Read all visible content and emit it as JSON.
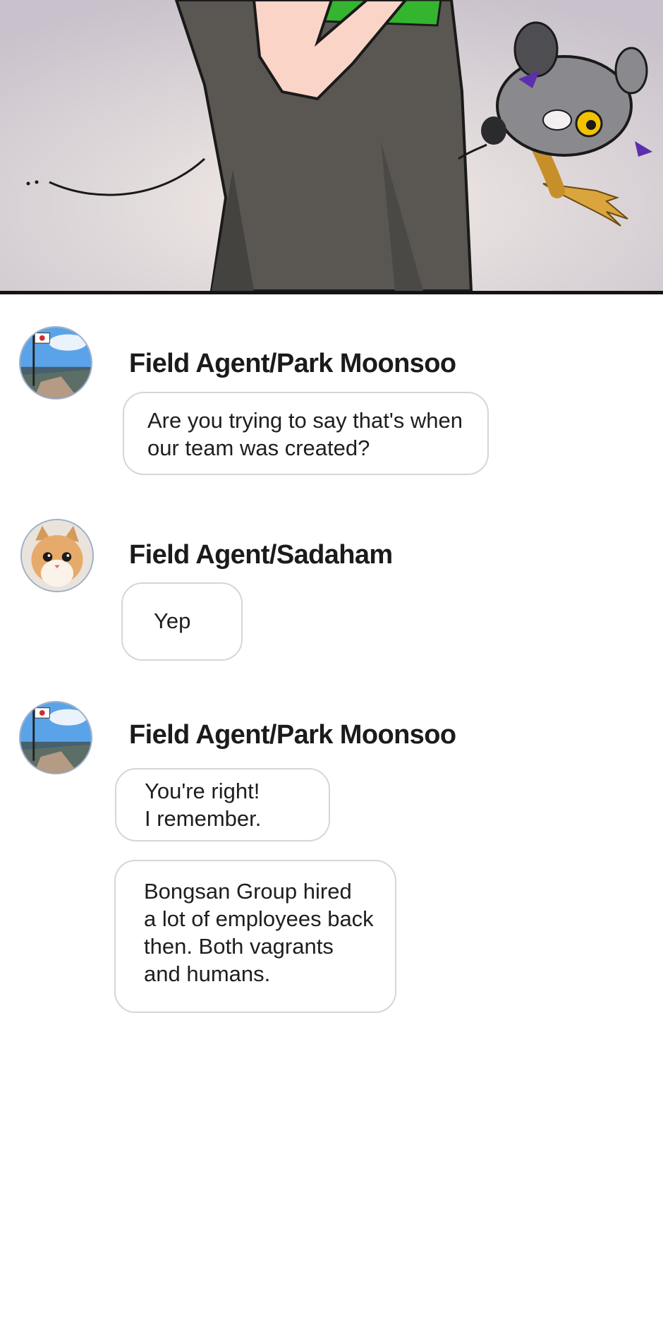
{
  "thread": [
    {
      "sender": "Field Agent/Park Moonsoo",
      "avatar_icon": "mountain-flag-icon",
      "messages": [
        {
          "lines": [
            "Are you trying to say that's when",
            "our team was created?"
          ]
        }
      ]
    },
    {
      "sender": "Field Agent/Sadaham",
      "avatar_icon": "kitten-icon",
      "messages": [
        {
          "lines": [
            "Yep"
          ]
        }
      ]
    },
    {
      "sender": "Field Agent/Park Moonsoo",
      "avatar_icon": "mountain-flag-icon",
      "messages": [
        {
          "lines": [
            "You're right!",
            "I remember."
          ]
        },
        {
          "lines": [
            "Bongsan Group hired",
            "a lot of employees back",
            "then. Both vagrants",
            "and humans."
          ]
        }
      ]
    }
  ],
  "colors": {
    "bubble_border": "#d6d6d6",
    "sender_text": "#1b1b1b",
    "panel_border": "#141414"
  }
}
